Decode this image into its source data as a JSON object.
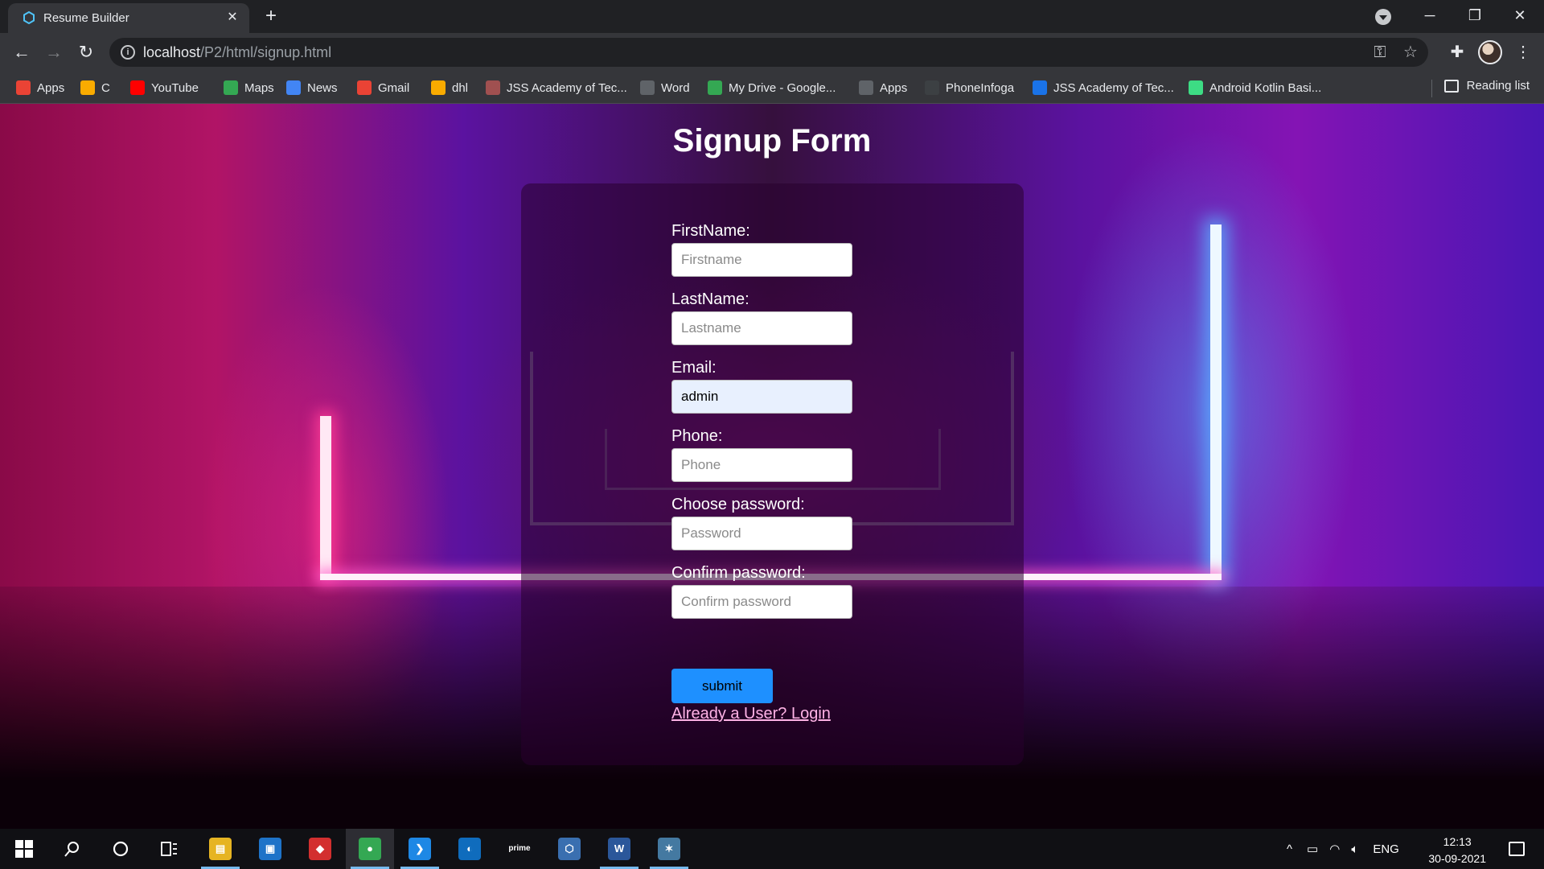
{
  "browser": {
    "tab_title": "Resume Builder",
    "url_host": "localhost",
    "url_path": "/P2/html/signup.html",
    "bookmarks": [
      {
        "label": "Apps",
        "icon": "apps-grid-icon",
        "color": "#ea4335"
      },
      {
        "label": "C",
        "icon": "c-bookmark-icon",
        "color": "#f9ab00"
      },
      {
        "label": "YouTube",
        "icon": "youtube-icon",
        "color": "#ff0000"
      },
      {
        "label": "Maps",
        "icon": "maps-pin-icon",
        "color": "#34a853"
      },
      {
        "label": "News",
        "icon": "news-icon",
        "color": "#4285f4"
      },
      {
        "label": "Gmail",
        "icon": "gmail-icon",
        "color": "#ea4335"
      },
      {
        "label": "dhl",
        "icon": "dhl-icon",
        "color": "#f9ab00"
      },
      {
        "label": "JSS Academy of Tec...",
        "icon": "jss-logo-icon",
        "color": "#a05050"
      },
      {
        "label": "Word",
        "icon": "globe-icon",
        "color": "#5f6368"
      },
      {
        "label": "My Drive - Google...",
        "icon": "google-drive-icon",
        "color": "#34a853"
      },
      {
        "label": "Apps",
        "icon": "apps-grid-icon",
        "color": "#5f6368"
      },
      {
        "label": "PhoneInfoga",
        "icon": "phoneinfoga-icon",
        "color": "#3c4043"
      },
      {
        "label": "JSS Academy of Tec...",
        "icon": "s-logo-icon",
        "color": "#1a73e8"
      },
      {
        "label": "Android Kotlin Basi...",
        "icon": "android-icon",
        "color": "#3ddc84"
      }
    ],
    "reading_list": "Reading list"
  },
  "page": {
    "title": "Signup Form",
    "fields": [
      {
        "label": "FirstName:",
        "placeholder": "Firstname",
        "value": ""
      },
      {
        "label": "LastName:",
        "placeholder": "Lastname",
        "value": ""
      },
      {
        "label": "Email:",
        "placeholder": "",
        "value": "admin"
      },
      {
        "label": "Phone:",
        "placeholder": "Phone",
        "value": ""
      },
      {
        "label": "Choose password:",
        "placeholder": "Password",
        "value": ""
      },
      {
        "label": "Confirm password:",
        "placeholder": "Confirm password",
        "value": ""
      }
    ],
    "submit_label": "submit",
    "login_link": "Already a User? Login",
    "accent_color": "#1e90ff"
  },
  "taskbar": {
    "apps": [
      {
        "name": "file-explorer-icon",
        "glyph": "▤",
        "color": "#e6b422"
      },
      {
        "name": "store-icon",
        "glyph": "▣",
        "color": "#1e73c8"
      },
      {
        "name": "anydesk-icon",
        "glyph": "◆",
        "color": "#d32f2f"
      },
      {
        "name": "chrome-icon",
        "glyph": "●",
        "color": "#34a853"
      },
      {
        "name": "vscode-icon",
        "glyph": "❯",
        "color": "#1e88e5"
      },
      {
        "name": "edge-icon",
        "glyph": "◐",
        "color": "#0f6cbd"
      },
      {
        "name": "prime-video-icon",
        "glyph": "prime",
        "color": "#101014"
      },
      {
        "name": "virtualbox-icon",
        "glyph": "⬡",
        "color": "#3a6fb0"
      },
      {
        "name": "word-icon",
        "glyph": "W",
        "color": "#2b579a"
      },
      {
        "name": "mysql-workbench-icon",
        "glyph": "✶",
        "color": "#4479a1"
      }
    ],
    "language": "ENG",
    "time": "12:13",
    "date": "30-09-2021"
  }
}
